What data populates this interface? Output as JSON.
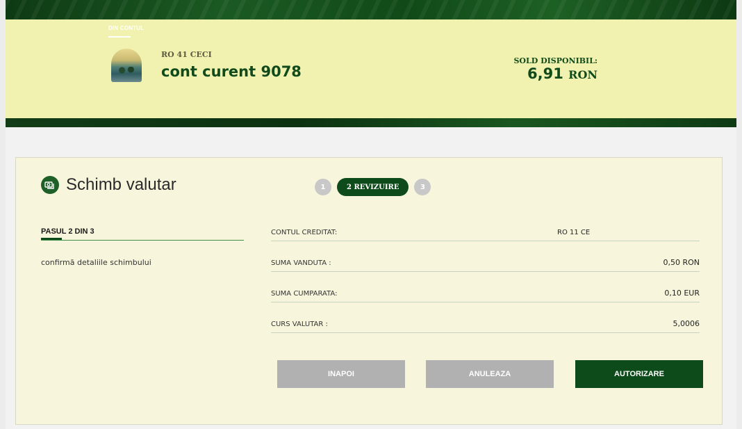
{
  "account": {
    "from_label": "DIN CONTUL",
    "iban": "RO 41 CECI",
    "name": "cont curent 9078",
    "balance_label": "SOLD DISPONIBIL:",
    "balance_amount": "6,91",
    "balance_currency": "RON"
  },
  "page": {
    "title": "Schimb valutar",
    "icon": "currency-exchange-icon"
  },
  "stepper": {
    "steps": [
      {
        "label": "1",
        "active": false
      },
      {
        "label": "2 REVIZUIRE",
        "active": true
      },
      {
        "label": "3",
        "active": false
      }
    ]
  },
  "step_info": {
    "label": "PASUL 2 DIN 3",
    "description": "confirmă detaliile schimbului"
  },
  "details": [
    {
      "label": "CONTUL CREDITAT:",
      "value": "RO 11 CE"
    },
    {
      "label": "SUMA VANDUTA :",
      "value": "0,50 RON"
    },
    {
      "label": "SUMA CUMPARATA:",
      "value": "0,10 EUR"
    },
    {
      "label": "CURS VALUTAR :",
      "value": "5,0006"
    }
  ],
  "buttons": {
    "back": "INAPOI",
    "cancel": "ANULEAZA",
    "authorize": "AUTORIZARE"
  },
  "colors": {
    "brand_dark_green": "#0e4b1a",
    "panel_yellow": "#f1f2b0",
    "card_background": "#f7f6dc",
    "disabled_button": "#b1b1b1"
  }
}
